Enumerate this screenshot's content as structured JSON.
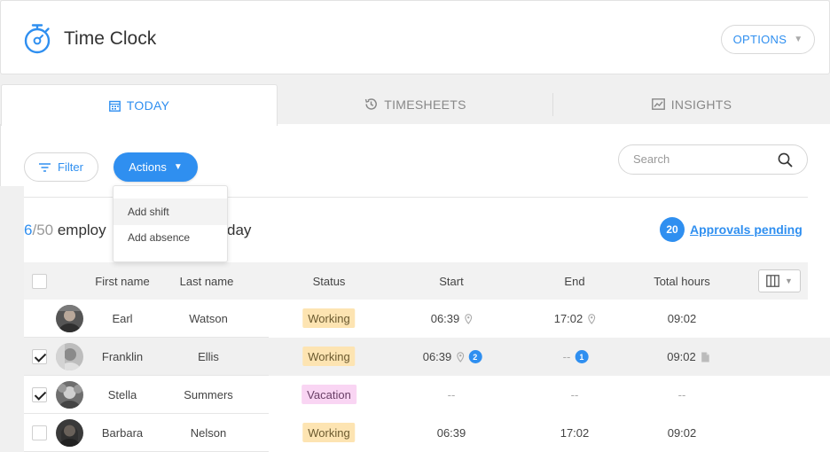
{
  "header": {
    "title": "Time Clock",
    "options_label": "OPTIONS"
  },
  "tabs": [
    {
      "label": "TODAY",
      "icon": "calendar-icon",
      "active": true
    },
    {
      "label": "TIMESHEETS",
      "icon": "history-clock-icon",
      "active": false
    },
    {
      "label": "INSIGHTS",
      "icon": "line-chart-icon",
      "active": false
    }
  ],
  "toolbar": {
    "filter_label": "Filter",
    "actions_label": "Actions",
    "search_placeholder": "Search"
  },
  "actions_menu": {
    "items": [
      "Add shift",
      "Add absence"
    ]
  },
  "summary": {
    "count": "6",
    "total": "/50",
    "text_start": " employ",
    "text_end": "day"
  },
  "approvals": {
    "count": "20",
    "label": "Approvals pending"
  },
  "table": {
    "columns": [
      "First name",
      "Last name",
      "Status",
      "Start",
      "End",
      "Total hours"
    ],
    "rows": [
      {
        "checked": false,
        "first": "Earl",
        "last": "Watson",
        "status": "Working",
        "status_type": "working",
        "start": "06:39",
        "end": "17:02",
        "total": "09:02",
        "start_pin": true,
        "end_pin": true,
        "start_badge": "",
        "end_badge": "",
        "total_doc": false
      },
      {
        "checked": true,
        "first": "Franklin",
        "last": "Ellis",
        "status": "Working",
        "status_type": "working",
        "start": "06:39",
        "end": "--",
        "total": "09:02",
        "start_pin": true,
        "end_pin": false,
        "start_badge": "2",
        "end_badge": "1",
        "total_doc": true
      },
      {
        "checked": true,
        "first": "Stella",
        "last": "Summers",
        "status": "Vacation",
        "status_type": "vacation",
        "start": "--",
        "end": "--",
        "total": "--",
        "start_pin": false,
        "end_pin": false,
        "start_badge": "",
        "end_badge": "",
        "total_doc": false
      },
      {
        "checked": false,
        "first": "Barbara",
        "last": "Nelson",
        "status": "Working",
        "status_type": "working",
        "start": "06:39",
        "end": "17:02",
        "total": "09:02",
        "start_pin": false,
        "end_pin": false,
        "start_badge": "",
        "end_badge": "",
        "total_doc": false
      }
    ]
  },
  "colors": {
    "accent": "#2f8ff0",
    "working": "#fde4b2",
    "vacation": "#f9d5f3"
  }
}
